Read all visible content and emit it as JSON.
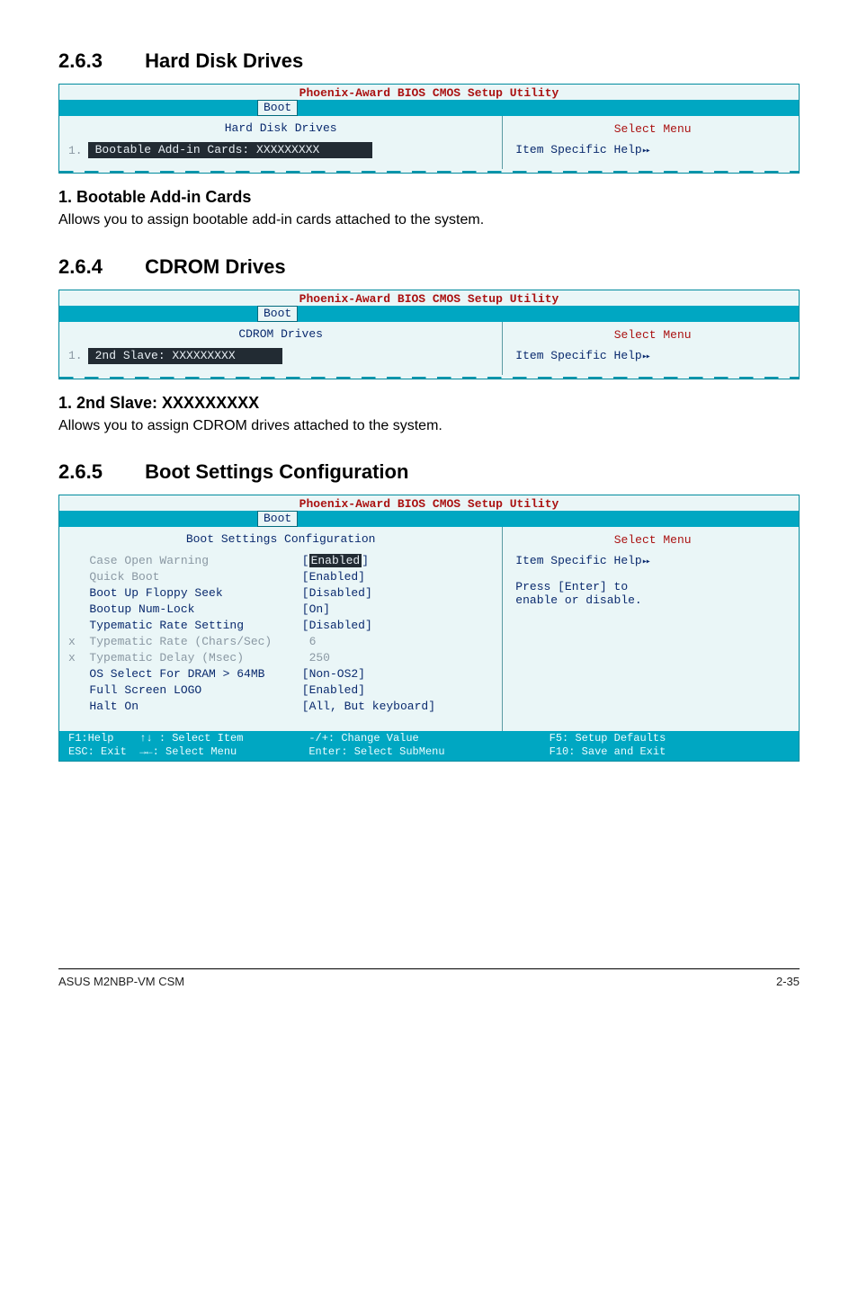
{
  "sections": {
    "s263": {
      "num": "2.6.3",
      "title": "Hard Disk Drives"
    },
    "s264": {
      "num": "2.6.4",
      "title": "CDROM Drives"
    },
    "s265": {
      "num": "2.6.5",
      "title": "Boot Settings Configuration"
    }
  },
  "bios": {
    "util_title": "Phoenix-Award BIOS CMOS Setup Utility",
    "tab": "Boot",
    "select_menu": "Select Menu",
    "item_help": "Item Specific Help"
  },
  "hdd": {
    "pane_title": "Hard Disk Drives",
    "rownum": "1.",
    "item": "Bootable Add-in Cards: XXXXXXXXX",
    "sub_heading": "1. Bootable Add-in Cards",
    "sub_text": "Allows you to assign bootable add-in cards attached to the system."
  },
  "cdrom": {
    "pane_title": "CDROM Drives",
    "rownum": "1.",
    "item": "2nd Slave: XXXXXXXXX",
    "sub_heading": "1. 2nd Slave: XXXXXXXXX",
    "sub_text": "Allows you to assign CDROM drives attached to the system."
  },
  "cfg": {
    "pane_title": "Boot Settings Configuration",
    "help1": "Press [Enter] to",
    "help2": "enable or disable.",
    "labels": {
      "l0": "   Case Open Warning",
      "l1": "   Quick Boot",
      "l2": "   Boot Up Floppy Seek",
      "l3": "   Bootup Num-Lock",
      "l4": "   Typematic Rate Setting",
      "l5": "x  Typematic Rate (Chars/Sec)",
      "l6": "x  Typematic Delay (Msec)",
      "l7": "   OS Select For DRAM > 64MB",
      "l8": "   Full Screen LOGO",
      "l9": "   Halt On"
    },
    "values": {
      "v0a": "[",
      "v0b": "Enabled",
      "v0c": "]",
      "v1": "[Enabled]",
      "v2": "[Disabled]",
      "v3": "[On]",
      "v4": "[Disabled]",
      "v5": " 6",
      "v6": " 250",
      "v7": "[Non-OS2]",
      "v8": "[Enabled]",
      "v9": "[All, But keyboard]"
    },
    "footer": {
      "c1a": "F1:Help    ↑↓ : Select Item",
      "c1b": "ESC: Exit  →←: Select Menu",
      "c2a": "-/+: Change Value",
      "c2b": "Enter: Select SubMenu",
      "c3a": "F5: Setup Defaults",
      "c3b": "F10: Save and Exit"
    }
  },
  "pagefoot": {
    "left": "ASUS M2NBP-VM CSM",
    "right": "2-35"
  }
}
